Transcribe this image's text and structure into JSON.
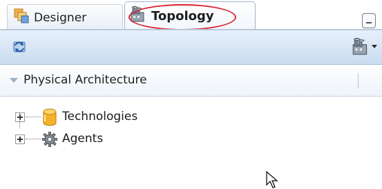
{
  "tabs": [
    {
      "label": "Designer",
      "icon": "designer-icon",
      "active": false
    },
    {
      "label": "Topology",
      "icon": "topology-icon",
      "active": true
    }
  ],
  "toolbar": {
    "refresh_icon": "refresh-icon",
    "topology_menu_icon": "topology-icon"
  },
  "section": {
    "title": "Physical Architecture",
    "expanded": true
  },
  "tree": {
    "nodes": [
      {
        "label": "Technologies",
        "icon": "database-icon",
        "expanded": false
      },
      {
        "label": "Agents",
        "icon": "gear-icon",
        "expanded": false
      }
    ]
  },
  "colors": {
    "annotation_circle": "#d8232f",
    "toolbar_top": "#e7f0fb",
    "toolbar_bottom": "#c9dcf0"
  }
}
